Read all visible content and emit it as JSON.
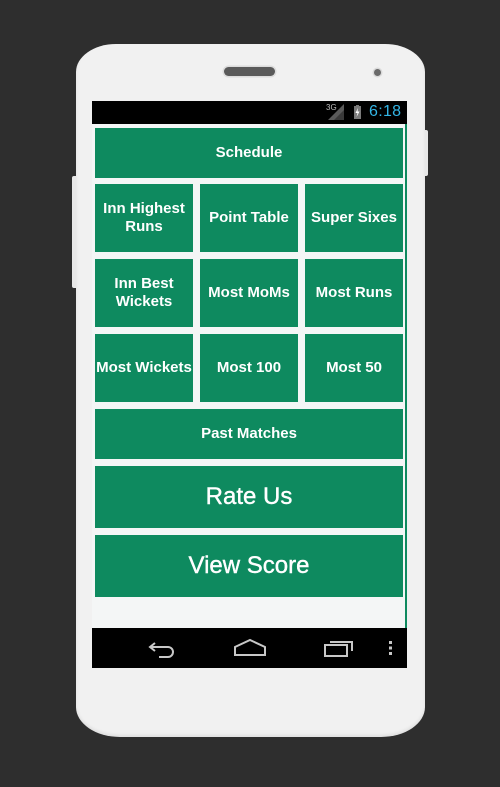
{
  "status_bar": {
    "network": "3G",
    "time": "6:18",
    "clock_color": "#33b5e5"
  },
  "theme": {
    "button_color": "#0e8a5f",
    "background": "#f4f6f6"
  },
  "menu": {
    "schedule": "Schedule",
    "grid": [
      [
        "Inn Highest Runs",
        "Point Table",
        "Super Sixes"
      ],
      [
        "Inn Best Wickets",
        "Most MoMs",
        "Most Runs"
      ],
      [
        "Most Wickets",
        "Most 100",
        "Most 50"
      ]
    ],
    "past_matches": "Past Matches",
    "rate_us": "Rate Us",
    "view_score": "View Score"
  },
  "nav_bar": {
    "icons": [
      "back-icon",
      "home-icon",
      "recent-apps-icon",
      "overflow-menu-icon"
    ]
  }
}
